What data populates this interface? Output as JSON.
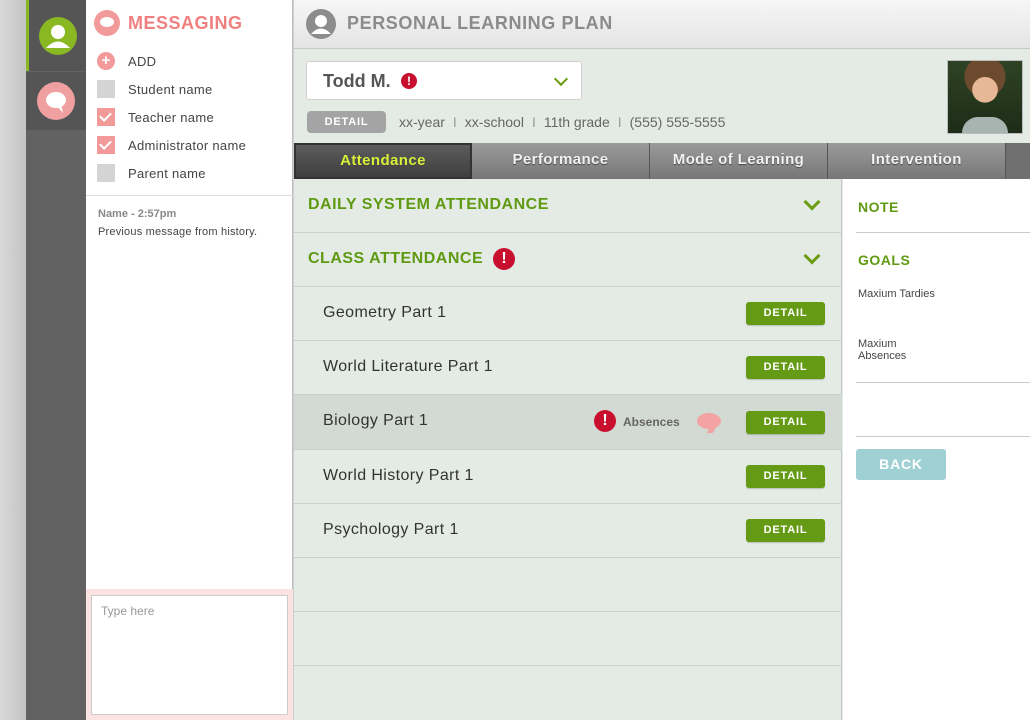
{
  "messaging": {
    "title": "MESSAGING",
    "add_label": "ADD",
    "recipients": [
      {
        "label": "Student name",
        "checked": false
      },
      {
        "label": "Teacher name",
        "checked": true
      },
      {
        "label": "Administrator name",
        "checked": true
      },
      {
        "label": "Parent name",
        "checked": false
      }
    ],
    "history": {
      "name": "Name - 2:57pm",
      "text": "Previous message from history."
    },
    "compose_placeholder": "Type here"
  },
  "header": {
    "title": "PERSONAL LEARNING PLAN"
  },
  "student": {
    "name": "Todd M.",
    "alert_glyph": "!",
    "detail_label": "DETAIL",
    "year": "xx-year",
    "school": "xx-school",
    "grade": "11th grade",
    "phone": "(555) 555-5555",
    "separator": "I"
  },
  "tabs": [
    "Attendance",
    "Performance",
    "Mode of Learning",
    "Intervention"
  ],
  "sections": {
    "daily": "DAILY SYSTEM ATTENDANCE",
    "class": "CLASS ATTENDANCE"
  },
  "courses": [
    {
      "name": "Geometry Part 1",
      "detail": "DETAIL"
    },
    {
      "name": "World Literature Part 1",
      "detail": "DETAIL"
    },
    {
      "name": "Biology Part 1",
      "detail": "DETAIL",
      "flag": "Absences"
    },
    {
      "name": "World History Part 1",
      "detail": "DETAIL"
    },
    {
      "name": "Psychology Part 1",
      "detail": "DETAIL"
    }
  ],
  "side": {
    "note": "NOTE",
    "goals": "GOALS",
    "max_tardies": "Maxium Tardies",
    "max_absences": "Maxium Absences",
    "back": "BACK"
  },
  "colors": {
    "accent_green": "#649a14",
    "pink": "#f29a9a",
    "alert_red": "#c8102e"
  }
}
